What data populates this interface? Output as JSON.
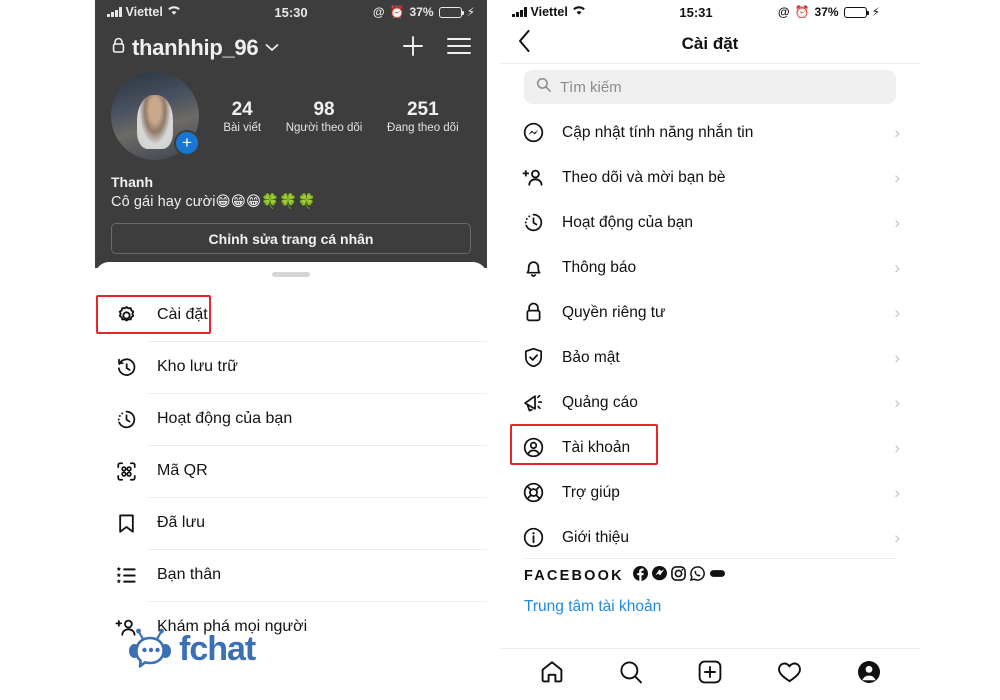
{
  "left_phone": {
    "status_bar": {
      "carrier": "Viettel",
      "time": "15:30",
      "battery": "37%"
    },
    "profile": {
      "username": "thanhhip_96",
      "lock_icon": "lock-icon",
      "stats": [
        {
          "num": "24",
          "label": "Bài viết"
        },
        {
          "num": "98",
          "label": "Người theo dõi"
        },
        {
          "num": "251",
          "label": "Đang theo dõi"
        }
      ],
      "display_name": "Thanh",
      "bio": "Cô gái hay cười😁😁😁🍀🍀🍀",
      "edit_button": "Chỉnh sửa trang cá nhân"
    },
    "menu": [
      {
        "label": "Cài đặt",
        "icon": "settings-gear-icon",
        "highlighted": true
      },
      {
        "label": "Kho lưu trữ",
        "icon": "archive-clock-icon",
        "highlighted": false
      },
      {
        "label": "Hoạt động của bạn",
        "icon": "activity-clock-icon",
        "highlighted": false
      },
      {
        "label": "Mã QR",
        "icon": "qr-code-icon",
        "highlighted": false
      },
      {
        "label": "Đã lưu",
        "icon": "bookmark-icon",
        "highlighted": false
      },
      {
        "label": "Bạn thân",
        "icon": "close-friends-list-icon",
        "highlighted": false
      },
      {
        "label": "Khám phá mọi người",
        "icon": "discover-people-icon",
        "highlighted": false
      }
    ],
    "watermark": {
      "text": "fchat",
      "icon": "fchat-robot-icon",
      "color": "#3b6fb6"
    }
  },
  "right_phone": {
    "status_bar": {
      "carrier": "Viettel",
      "time": "15:31",
      "battery": "37%"
    },
    "header": {
      "title": "Cài đặt",
      "back_icon": "chevron-left-icon"
    },
    "search": {
      "placeholder": "Tìm kiếm",
      "icon": "search-icon"
    },
    "settings": [
      {
        "label": "Cập nhật tính năng nhắn tin",
        "icon": "messenger-icon",
        "highlighted": false
      },
      {
        "label": "Theo dõi và mời bạn bè",
        "icon": "add-person-icon",
        "highlighted": false
      },
      {
        "label": "Hoạt động của bạn",
        "icon": "activity-clock-icon",
        "highlighted": false
      },
      {
        "label": "Thông báo",
        "icon": "bell-icon",
        "highlighted": false
      },
      {
        "label": "Quyền riêng tư",
        "icon": "lock-icon",
        "highlighted": false
      },
      {
        "label": "Bảo mật",
        "icon": "shield-check-icon",
        "highlighted": false
      },
      {
        "label": "Quảng cáo",
        "icon": "megaphone-icon",
        "highlighted": false
      },
      {
        "label": "Tài khoản",
        "icon": "account-person-icon",
        "highlighted": true
      },
      {
        "label": "Trợ giúp",
        "icon": "lifebuoy-icon",
        "highlighted": false
      },
      {
        "label": "Giới thiệu",
        "icon": "info-icon",
        "highlighted": false
      }
    ],
    "facebook_section": {
      "label": "FACEBOOK",
      "icons": [
        "facebook-icon",
        "messenger-icon",
        "instagram-icon",
        "whatsapp-icon",
        "portal-icon"
      ],
      "account_center_link": "Trung tâm tài khoản",
      "link_color": "#1f8ae0"
    },
    "tabbar": [
      {
        "icon": "home-icon"
      },
      {
        "icon": "search-icon"
      },
      {
        "icon": "add-post-icon"
      },
      {
        "icon": "heart-icon"
      },
      {
        "icon": "profile-avatar-icon"
      }
    ]
  },
  "annotations": {
    "highlight_color": "#e8262a"
  }
}
